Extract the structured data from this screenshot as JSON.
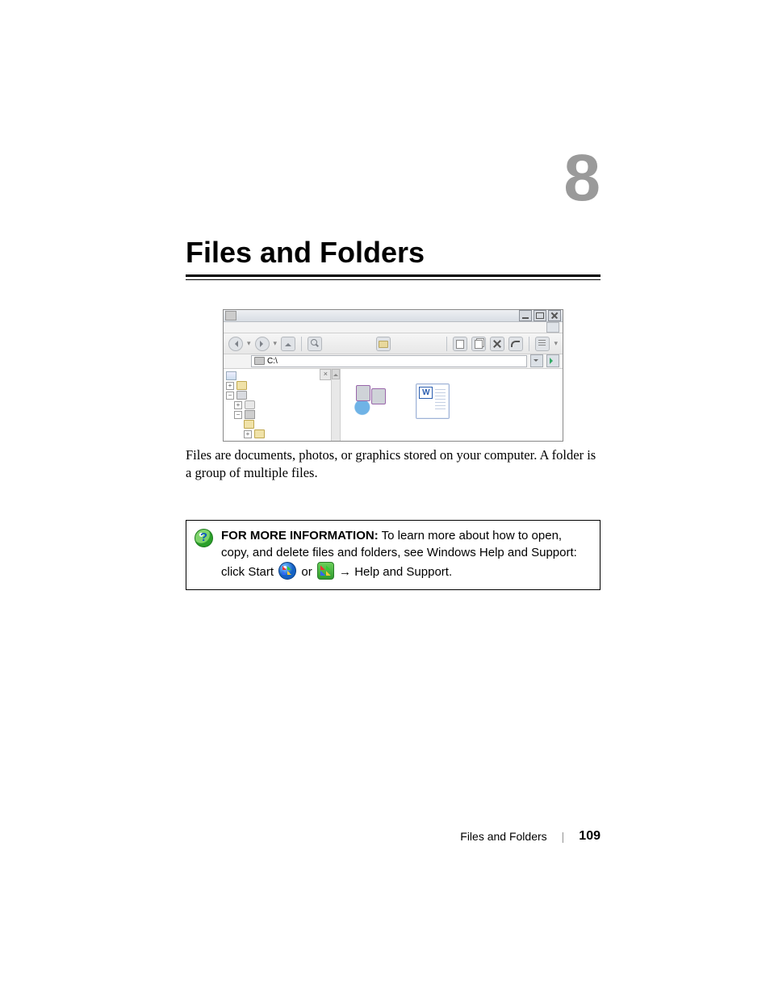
{
  "chapter": {
    "number": "8",
    "title": "Files and Folders"
  },
  "explorer": {
    "address_path": "C:\\",
    "tree_close": "×",
    "expanders": {
      "plus": "+",
      "minus": "−"
    }
  },
  "paragraph": "Files are documents, photos, or graphics stored on your computer. A folder is a group of multiple files.",
  "info": {
    "lead": "FOR MORE INFORMATION:",
    "text1": " To learn more about how to open, copy, and delete files and folders, see Windows Help and Support: click Start ",
    "or": " or ",
    "arrow_help": " → Help and Support."
  },
  "footer": {
    "section": "Files and Folders",
    "page": "109"
  }
}
